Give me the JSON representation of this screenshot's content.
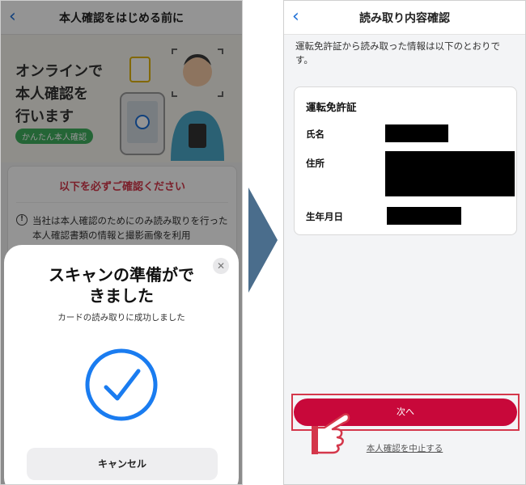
{
  "left_screen": {
    "nav": {
      "back_icon": "chevron-left-icon",
      "title": "本人確認をはじめる前に"
    },
    "hero": {
      "line1": "オンラインで",
      "line2": "本人確認を",
      "line3": "行います",
      "badge": "かんたん本人確認"
    },
    "notice": {
      "heading": "以下を必ずご確認ください",
      "body": "当社は本人確認のためにのみ読み取りを行った本人確認書類の情報と撮影画像を利用"
    },
    "sheet": {
      "title_line1": "スキャンの準備がで",
      "title_line2": "きました",
      "subtitle": "カードの読み取りに成功しました",
      "close_icon": "close-icon",
      "check_icon": "checkmark-circle-icon",
      "cancel_label": "キャンセル"
    }
  },
  "right_screen": {
    "nav": {
      "back_icon": "chevron-left-icon",
      "title": "読み取り内容確認"
    },
    "intro": "運転免許証から読み取った情報は以下のとおりです。",
    "card": {
      "heading": "運転免許証",
      "fields": [
        {
          "label": "氏名"
        },
        {
          "label": "住所"
        },
        {
          "label": "生年月日"
        }
      ]
    },
    "next_label": "次へ",
    "cancel_link": "本人確認を中止する"
  },
  "colors": {
    "accent_blue": "#1d6fd6",
    "brand_red": "#c8083a",
    "highlight_red": "#d4374b",
    "flow_arrow": "#4a6d8c"
  }
}
